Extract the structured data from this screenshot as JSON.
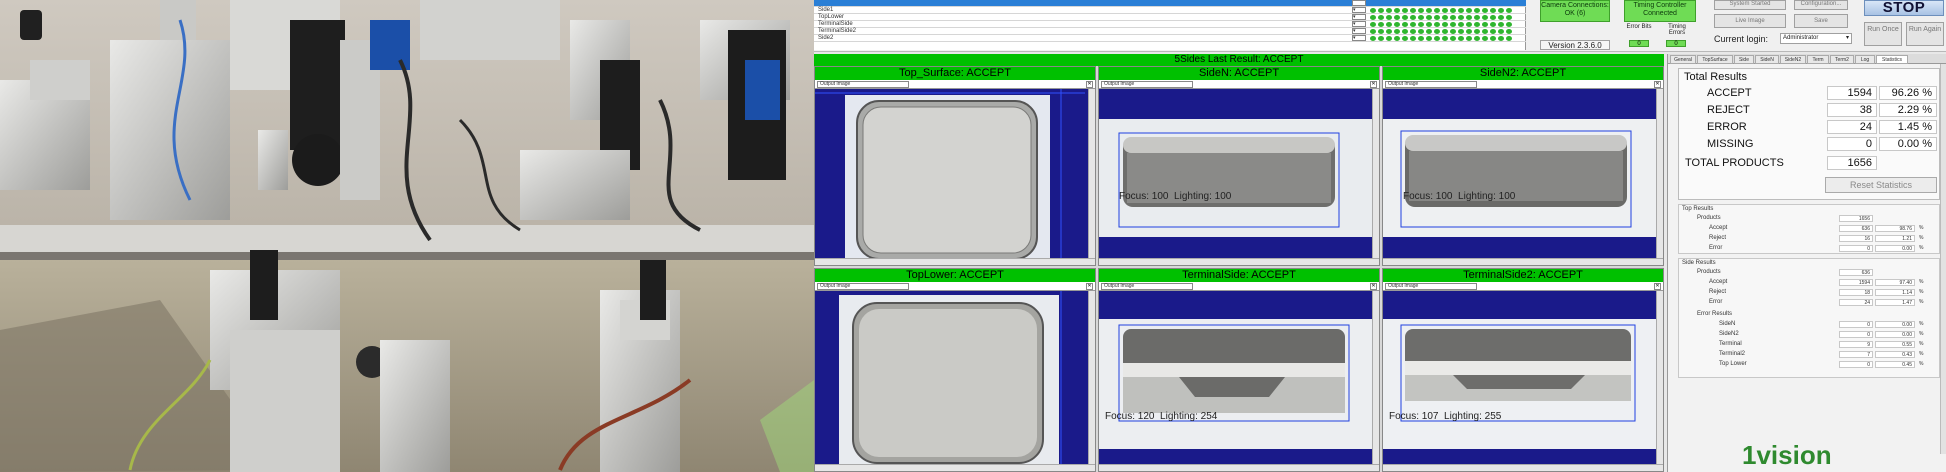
{
  "top": {
    "camera_rows": [
      "",
      "Side1",
      "TopLower",
      "TerminalSide",
      "TerminalSide2",
      "Side2"
    ],
    "camera_connections": "Camera Connections: OK (6)",
    "timing_controller": "Timing Controller Connected",
    "version": "Version 2.3.6.0",
    "error_bits_label": "Error Bits",
    "error_bits_value": "0",
    "timing_errors_label": "Timing Errors",
    "timing_errors_value": "0",
    "system_status": "System Started",
    "configuration_button": "Configuration...",
    "live_image_button": "Live Image",
    "save_button": "Save",
    "current_login_label": "Current login:",
    "current_login_value": "Administrator",
    "stop_button": "STOP",
    "run_once_button": "Run Once",
    "run_again_button": "Run Again"
  },
  "grid": {
    "title": "5Sides Last Result: ACCEPT",
    "cells": [
      {
        "title": "Top_Surface: ACCEPT",
        "select": "Output Image",
        "focus": "",
        "lighting": ""
      },
      {
        "title": "SideN: ACCEPT",
        "select": "Output Image",
        "focus": "Focus: 100",
        "lighting": "Lighting: 100"
      },
      {
        "title": "SideN2: ACCEPT",
        "select": "Output Image",
        "focus": "Focus: 100",
        "lighting": "Lighting: 100"
      },
      {
        "title": "TopLower: ACCEPT",
        "select": "Output Image",
        "focus": "",
        "lighting": ""
      },
      {
        "title": "TerminalSide: ACCEPT",
        "select": "Output Image",
        "focus": "Focus: 120",
        "lighting": "Lighting: 254"
      },
      {
        "title": "TerminalSide2: ACCEPT",
        "select": "Output Image",
        "focus": "Focus: 107",
        "lighting": "Lighting: 255"
      }
    ]
  },
  "results": {
    "tabs": [
      "General",
      "TopSurface",
      "Side",
      "SideN",
      "SideN2",
      "Term",
      "Term2",
      "Log",
      "Statistics"
    ],
    "total_results_label": "Total Results",
    "rows": [
      {
        "label": "ACCEPT",
        "count": "1594",
        "percent": "96.26 %"
      },
      {
        "label": "REJECT",
        "count": "38",
        "percent": "2.29 %"
      },
      {
        "label": "ERROR",
        "count": "24",
        "percent": "1.45 %"
      },
      {
        "label": "MISSING",
        "count": "0",
        "percent": "0.00 %"
      }
    ],
    "total_products_label": "TOTAL PRODUCTS",
    "total_products_value": "1656",
    "reset_button": "Reset Statistics",
    "top_results": {
      "header": "Top Results",
      "products_label": "Products",
      "products_value": "1656",
      "rows": [
        {
          "label": "Accept",
          "count": "636",
          "percent": "98.76",
          "unit": "%"
        },
        {
          "label": "Reject",
          "count": "16",
          "percent": "1.21",
          "unit": "%"
        },
        {
          "label": "Error",
          "count": "0",
          "percent": "0.00",
          "unit": "%"
        }
      ]
    },
    "side_results": {
      "header": "Side Results",
      "products_label": "Products",
      "products_value": "636",
      "rows": [
        {
          "label": "Accept",
          "count": "1594",
          "percent": "97.40",
          "unit": "%"
        },
        {
          "label": "Reject",
          "count": "18",
          "percent": "1.14",
          "unit": "%"
        },
        {
          "label": "Error",
          "count": "24",
          "percent": "1.47",
          "unit": "%"
        }
      ],
      "error_header": "Error Results",
      "error_rows": [
        {
          "label": "SideN",
          "count": "0",
          "percent": "0.00",
          "unit": "%"
        },
        {
          "label": "SideN2",
          "count": "0",
          "percent": "0.00",
          "unit": "%"
        },
        {
          "label": "Terminal",
          "count": "9",
          "percent": "0.55",
          "unit": "%"
        },
        {
          "label": "Terminal2",
          "count": "7",
          "percent": "0.43",
          "unit": "%"
        },
        {
          "label": "Top Lower",
          "count": "0",
          "percent": "0.45",
          "unit": "%"
        }
      ]
    },
    "logo_text": "1vision"
  },
  "colors": {
    "accept_green": "#00c000",
    "image_background": "#1a1a8a",
    "selection_blue": "#2a7fd6"
  }
}
